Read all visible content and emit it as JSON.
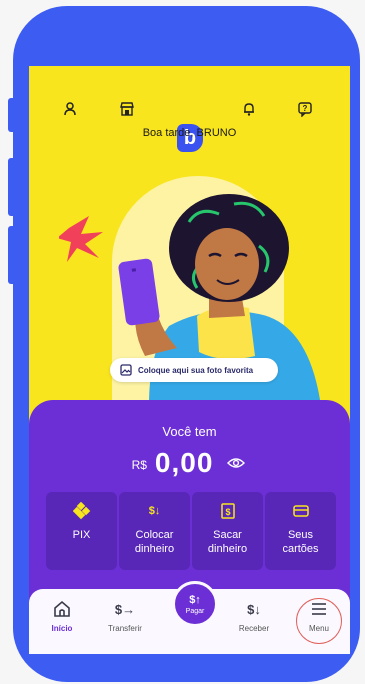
{
  "header": {
    "logo_letter": "b",
    "greeting": "Boa tarde, BRUNO",
    "icons": [
      "profile-icon",
      "store-icon",
      "bell-icon",
      "help-chat-icon"
    ]
  },
  "photo": {
    "hint": "Coloque aqui sua foto favorita",
    "hint_icon": "image-icon"
  },
  "balance": {
    "label": "Você tem",
    "currency": "R$",
    "amount": "0,00",
    "toggle_icon": "eye-icon"
  },
  "actions": [
    {
      "label": "PIX",
      "icon": "pix-icon"
    },
    {
      "label": "Colocar\ndinheiro",
      "icon": "deposit-icon",
      "glyph": "$↓"
    },
    {
      "label": "Sacar\ndinheiro",
      "icon": "withdraw-icon",
      "glyph": "$"
    },
    {
      "label": "Seus\ncartões",
      "icon": "card-icon"
    }
  ],
  "bottom_nav": {
    "items": [
      {
        "label": "Início",
        "icon": "home-icon",
        "active": true
      },
      {
        "label": "Transferir",
        "icon": "transfer-icon",
        "glyph": "$→"
      },
      {
        "label": "Pagar",
        "icon": "pay-icon",
        "glyph": "$↑"
      },
      {
        "label": "Receber",
        "icon": "receive-icon",
        "glyph": "$↓"
      },
      {
        "label": "Menu",
        "icon": "menu-icon"
      }
    ]
  },
  "colors": {
    "phone_frame": "#3c5cf2",
    "screen_bg": "#f9e51d",
    "card_bg": "#6c2fd5",
    "accent_yellow": "#f9e51d",
    "highlight_ring": "#e0605a"
  }
}
